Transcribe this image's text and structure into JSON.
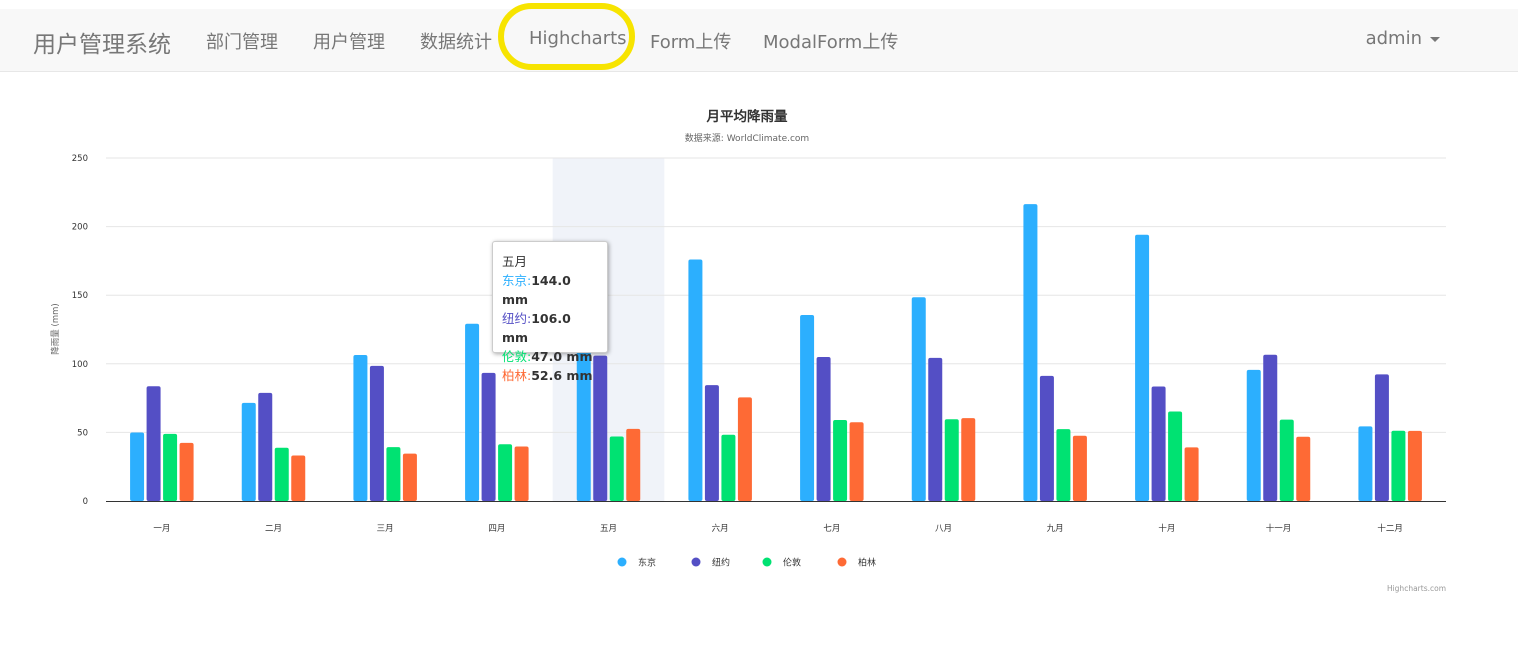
{
  "navbar": {
    "brand": "用户管理系统",
    "items": [
      "部门管理",
      "用户管理",
      "数据统计",
      "Highcharts",
      "Form上传",
      "ModalForm上传"
    ],
    "user": "admin"
  },
  "chart_data": {
    "type": "bar",
    "title": "月平均降雨量",
    "subtitle": "数据来源: WorldClimate.com",
    "xlabel": "",
    "ylabel": "降雨量 (mm)",
    "ylim": [
      0,
      250
    ],
    "yticks": [
      0,
      50,
      100,
      150,
      200,
      250
    ],
    "grid": true,
    "legend_position": "bottom",
    "categories": [
      "一月",
      "二月",
      "三月",
      "四月",
      "五月",
      "六月",
      "七月",
      "八月",
      "九月",
      "十月",
      "十一月",
      "十二月"
    ],
    "series": [
      {
        "name": "东京",
        "color": "#2caffe",
        "values": [
          49.9,
          71.5,
          106.4,
          129.2,
          144.0,
          176.0,
          135.6,
          148.5,
          216.4,
          194.1,
          95.6,
          54.4
        ]
      },
      {
        "name": "纽约",
        "color": "#544fc5",
        "values": [
          83.6,
          78.8,
          98.5,
          93.4,
          106.0,
          84.5,
          105.0,
          104.3,
          91.2,
          83.5,
          106.6,
          92.3
        ]
      },
      {
        "name": "伦敦",
        "color": "#00e272",
        "values": [
          48.9,
          38.8,
          39.3,
          41.4,
          47.0,
          48.3,
          59.0,
          59.6,
          52.4,
          65.2,
          59.3,
          51.2
        ]
      },
      {
        "name": "柏林",
        "color": "#fe6a35",
        "values": [
          42.4,
          33.2,
          34.5,
          39.7,
          52.6,
          75.5,
          57.4,
          60.4,
          47.6,
          39.1,
          46.8,
          51.1
        ]
      }
    ],
    "highlight_index": 4,
    "tooltip": {
      "title": "五月",
      "rows": [
        {
          "label": "东京",
          "value": "144.0 mm",
          "color": "#2caffe"
        },
        {
          "label": "纽约",
          "value": "106.0 mm",
          "color": "#544fc5"
        },
        {
          "label": "伦敦",
          "value": "47.0 mm",
          "color": "#00e272"
        },
        {
          "label": "柏林",
          "value": "52.6 mm",
          "color": "#fe6a35"
        }
      ]
    },
    "credits": "Highcharts.com"
  }
}
